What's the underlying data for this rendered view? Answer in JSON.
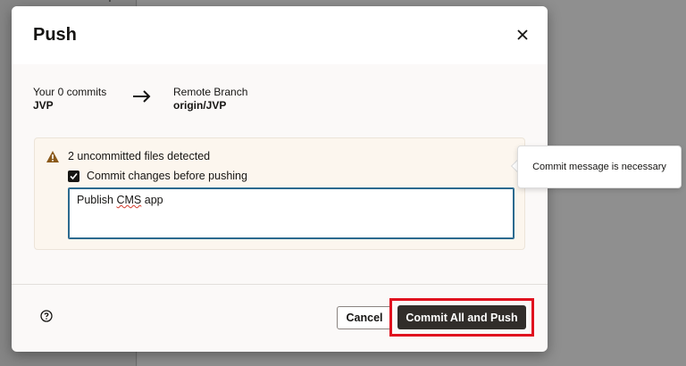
{
  "dialog": {
    "title": "Push",
    "close_icon": "close-icon"
  },
  "branches": {
    "source_label": "Your 0 commits",
    "source_value": "JVP",
    "target_label": "Remote Branch",
    "target_value": "origin/JVP",
    "arrow_icon": "arrow-right-icon"
  },
  "warning": {
    "icon": "warning-triangle-icon",
    "text": "2 uncommitted files detected",
    "checkbox_label": "Commit changes before pushing",
    "checkbox_checked": true,
    "commit_message_value": "Publish CMS app",
    "commit_message_parts": [
      "Publish ",
      "CMS",
      " app"
    ]
  },
  "tooltip": {
    "text": "Commit message is necessary"
  },
  "footer": {
    "help_icon": "help-icon",
    "cancel_label": "Cancel",
    "primary_label": "Commit All and Push"
  },
  "colors": {
    "primary_button": "#312d2a",
    "highlight_border": "#e0121f",
    "warning_icon": "#8b5a1a",
    "field_focus": "#2c6a8f"
  }
}
